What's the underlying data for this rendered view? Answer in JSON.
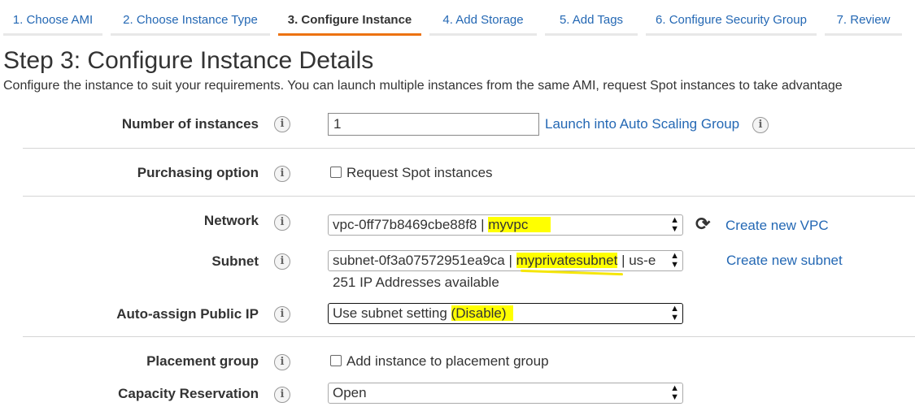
{
  "steps": [
    {
      "label": "1. Choose AMI"
    },
    {
      "label": "2. Choose Instance Type"
    },
    {
      "label": "3. Configure Instance"
    },
    {
      "label": "4. Add Storage"
    },
    {
      "label": "5. Add Tags"
    },
    {
      "label": "6. Configure Security Group"
    },
    {
      "label": "7. Review"
    }
  ],
  "active_step": 3,
  "page": {
    "title": "Step 3: Configure Instance Details",
    "subtitle": "Configure the instance to suit your requirements. You can launch multiple instances from the same AMI, request Spot instances to take advantage"
  },
  "form": {
    "instances": {
      "label": "Number of instances",
      "value": "1",
      "link": "Launch into Auto Scaling Group"
    },
    "purchasing": {
      "label": "Purchasing option",
      "checkbox_label": "Request Spot instances",
      "checked": false
    },
    "network": {
      "label": "Network",
      "value_prefix": "vpc-0ff77b8469cbe88f8 | ",
      "value_highlight": "myvpc",
      "link": "Create new VPC"
    },
    "subnet": {
      "label": "Subnet",
      "value_prefix": "subnet-0f3a07572951ea9ca | ",
      "value_highlight": "myprivatesubnet",
      "value_suffix": " | us-e",
      "note": "251 IP Addresses available",
      "link": "Create new subnet"
    },
    "public_ip": {
      "label": "Auto-assign Public IP",
      "value_prefix": "Use subnet setting ",
      "value_highlight": "(Disable)"
    },
    "placement": {
      "label": "Placement group",
      "checkbox_label": "Add instance to placement group",
      "checked": false
    },
    "capacity": {
      "label": "Capacity Reservation",
      "value": "Open"
    }
  },
  "icons": {
    "info": "info-icon",
    "refresh": "refresh-icon",
    "select_arrow": "updown-arrow-icon"
  },
  "colors": {
    "link": "#2468b4",
    "active_tab_underline": "#ec7211",
    "highlight": "#ffff00"
  }
}
